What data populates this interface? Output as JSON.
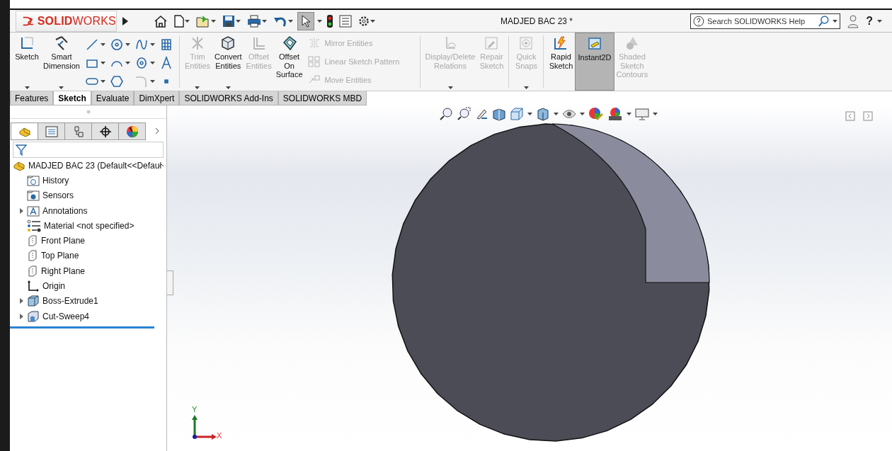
{
  "title_bar": {
    "logo": "**SOLID**WORKS",
    "document_title": "MADJED BAC 23 *",
    "help_search": {
      "placeholder": "Search SOLIDWORKS Help"
    },
    "help_label": "?"
  },
  "ribbon": {
    "big_buttons_left": [
      {
        "kind": "sketch",
        "label": "Sketch",
        "disabled": false,
        "dropdown": true,
        "selected": false
      },
      {
        "kind": "smart-dimension",
        "label": "Smart Dimension",
        "disabled": false,
        "dropdown": true,
        "selected": false
      }
    ],
    "big_buttons_mid": [
      {
        "kind": "trim",
        "label": "Trim Entities",
        "disabled": true,
        "dropdown": true,
        "selected": false
      },
      {
        "kind": "convert",
        "label": "Convert Entities",
        "disabled": false,
        "dropdown": true,
        "selected": false
      },
      {
        "kind": "offset",
        "label": "Offset Entities",
        "disabled": true,
        "dropdown": false,
        "selected": false
      },
      {
        "kind": "offset-surface",
        "label": "Offset On Surface",
        "disabled": false,
        "dropdown": false,
        "selected": false
      }
    ],
    "list_commands": [
      {
        "kind": "mirror",
        "label": "Mirror Entities",
        "disabled": true
      },
      {
        "kind": "pattern",
        "label": "Linear Sketch Pattern",
        "disabled": true
      },
      {
        "kind": "move",
        "label": "Move Entities",
        "disabled": true
      }
    ],
    "big_buttons_right": [
      {
        "kind": "relations",
        "label": "Display/Delete Relations",
        "disabled": true,
        "dropdown": true,
        "selected": false
      },
      {
        "kind": "repair",
        "label": "Repair Sketch",
        "disabled": true,
        "dropdown": false,
        "selected": false
      },
      {
        "kind": "snaps",
        "label": "Quick Snaps",
        "disabled": true,
        "dropdown": true,
        "selected": false
      },
      {
        "kind": "rapid",
        "label": "Rapid Sketch",
        "disabled": false,
        "dropdown": false,
        "selected": false
      },
      {
        "kind": "instant2d",
        "label": "Instant2D",
        "disabled": false,
        "dropdown": false,
        "selected": true
      },
      {
        "kind": "shaded",
        "label": "Shaded Sketch Contours",
        "disabled": true,
        "dropdown": false,
        "selected": false
      }
    ]
  },
  "tabs": [
    {
      "label": "Features",
      "selected": false
    },
    {
      "label": "Sketch",
      "selected": true
    },
    {
      "label": "Evaluate",
      "selected": false
    },
    {
      "label": "DimXpert",
      "selected": false
    },
    {
      "label": "SOLIDWORKS Add-Ins",
      "selected": false
    },
    {
      "label": "SOLIDWORKS MBD",
      "selected": false
    }
  ],
  "panel_tabs": [
    {
      "kind": "feature-tree",
      "selected": true
    },
    {
      "kind": "property",
      "selected": false
    },
    {
      "kind": "config",
      "selected": false
    },
    {
      "kind": "dimxpert",
      "selected": false
    },
    {
      "kind": "display",
      "selected": false
    }
  ],
  "tree": {
    "root": "MADJED BAC 23  (Default<<Defaul",
    "items": [
      {
        "kind": "history",
        "label": "History",
        "has_children": false
      },
      {
        "kind": "sensors",
        "label": "Sensors",
        "has_children": false
      },
      {
        "kind": "annotations",
        "label": "Annotations",
        "has_children": true
      },
      {
        "kind": "material",
        "label": "Material <not specified>",
        "has_children": false
      },
      {
        "kind": "plane",
        "label": "Front Plane",
        "has_children": false
      },
      {
        "kind": "plane",
        "label": "Top Plane",
        "has_children": false
      },
      {
        "kind": "plane",
        "label": "Right Plane",
        "has_children": false
      },
      {
        "kind": "origin",
        "label": "Origin",
        "has_children": false
      },
      {
        "kind": "boss",
        "label": "Boss-Extrude1",
        "has_children": true
      },
      {
        "kind": "cut",
        "label": "Cut-Sweep4",
        "has_children": true
      }
    ]
  },
  "viewport": {
    "axes": {
      "y_label": "Y",
      "x_label": "X"
    }
  }
}
